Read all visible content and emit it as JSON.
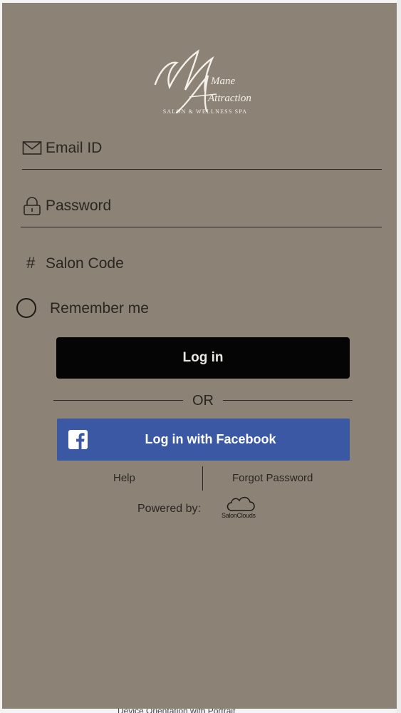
{
  "brand": {
    "logo_line1": "Mane",
    "logo_line2": "Attraction",
    "logo_subtitle": "SALON & WELLNESS SPA"
  },
  "form": {
    "email": {
      "label": "Email ID",
      "icon": "envelope-icon"
    },
    "password": {
      "label": "Password",
      "icon": "lock-icon"
    },
    "salon_code": {
      "label": "Salon Code",
      "icon": "hash-icon"
    },
    "remember_me": {
      "label": "Remember me",
      "checked": false
    }
  },
  "actions": {
    "login_label": "Log in",
    "or_label": "OR",
    "facebook_label": "Log in with Facebook",
    "help_label": "Help",
    "forgot_label": "Forgot Password"
  },
  "footer": {
    "powered_by": "Powered by:",
    "provider": "SalonClouds"
  },
  "background_text": "Device Orientation with Portrait",
  "colors": {
    "panel": "#8c8275",
    "login_button": "#050505",
    "facebook_button": "#3a58a4",
    "text": "#2a2622"
  }
}
